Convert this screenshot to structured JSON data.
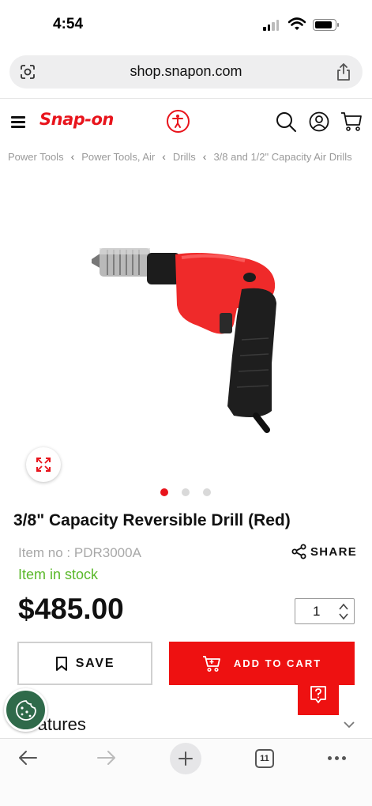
{
  "status_bar": {
    "time": "4:54"
  },
  "browser": {
    "url": "shop.snapon.com",
    "open_tabs": "11"
  },
  "header": {
    "logo_text": "Snap-on"
  },
  "breadcrumb": [
    "Power Tools",
    "Power Tools, Air",
    "Drills",
    "3/8 and 1/2\" Capacity Air Drills"
  ],
  "carousel": {
    "total_images": 3,
    "active_index": 0
  },
  "product": {
    "title": "3/8\" Capacity Reversible Drill (Red)",
    "item_no": "Item no : PDR3000A",
    "stock": "Item in stock",
    "price": "$485.00",
    "quantity": "1",
    "share_label": "SHARE",
    "save_label": "SAVE",
    "add_to_cart_label": "ADD TO CART"
  },
  "sections": {
    "features_label": "Features"
  },
  "colors": {
    "brand_red": "#e8141c",
    "in_stock_green": "#5ab82a",
    "cookie_green": "#2f6a4a"
  }
}
